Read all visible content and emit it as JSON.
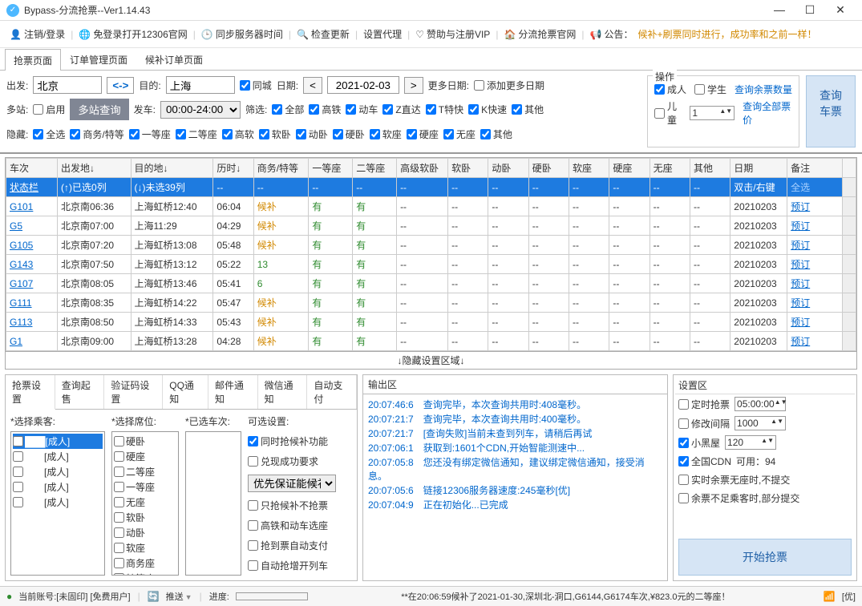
{
  "window": {
    "title": "Bypass-分流抢票--Ver1.14.43"
  },
  "toolbar": {
    "logout": "注销/登录",
    "openSite": "免登录打开12306官网",
    "sync": "同步服务器时间",
    "check": "检查更新",
    "proxy": "设置代理",
    "donate": "赞助与注册VIP",
    "site": "分流抢票官网",
    "notice": "公告：",
    "noticeMsg": "候补+刷票同时进行，成功率和之前一样！"
  },
  "mainTabs": {
    "t1": "抢票页面",
    "t2": "订单管理页面",
    "t3": "候补订单页面"
  },
  "search": {
    "fromLabel": "出发:",
    "fromVal": "北京",
    "toLabel": "目的:",
    "toVal": "上海",
    "sameCity": "同城",
    "dateLabel": "日期:",
    "dateVal": "2021-02-03",
    "moreDateLabel": "更多日期:",
    "addMoreDate": "添加更多日期",
    "multiLabel": "多站:",
    "enable": "启用",
    "multiBtn": "多站查询",
    "departLabel": "发车:",
    "departVal": "00:00-24:00",
    "filterLabel": "筛选:",
    "all": "全部",
    "gaotie": "高铁",
    "dongche": "动车",
    "zdirect": "Z直达",
    "tkuai": "T特快",
    "kkuai": "K快速",
    "other": "其他",
    "hideLabel": "隐藏:",
    "selAll": "全选",
    "bizFirst": "商务/特等",
    "first": "一等座",
    "second": "二等座",
    "gaoruan": "高软",
    "ruanwo": "软卧",
    "dongwo": "动卧",
    "yingwo": "硬卧",
    "ruanzuo": "软座",
    "yingzuo": "硬座",
    "wuzuo": "无座",
    "other2": "其他"
  },
  "ops": {
    "title": "操作",
    "adult": "成人",
    "student": "学生",
    "child": "儿童",
    "childNum": "1",
    "link1": "查询余票数量",
    "link2": "查询全部票价",
    "bigBtn": "查询\n车票"
  },
  "gridHeaders": [
    "车次",
    "出发地↓",
    "目的地↓",
    "历时↓",
    "商务/特等",
    "一等座",
    "二等座",
    "高级软卧",
    "软卧",
    "动卧",
    "硬卧",
    "软座",
    "硬座",
    "无座",
    "其他",
    "日期",
    "备注"
  ],
  "statusRow": {
    "a": "状态栏",
    "b": "(↑)已选0列",
    "c": "(↓)未选39列",
    "note": "双击/右键",
    "link": "全选"
  },
  "rows": [
    {
      "no": "G101",
      "from": "北京南06:36",
      "to": "上海虹桥12:40",
      "dur": "06:04",
      "biz": "候补",
      "c1": "有",
      "c2": "有",
      "date": "20210203",
      "act": "预订"
    },
    {
      "no": "G5",
      "from": "北京南07:00",
      "to": "上海11:29",
      "dur": "04:29",
      "biz": "候补",
      "c1": "有",
      "c2": "有",
      "date": "20210203",
      "act": "预订"
    },
    {
      "no": "G105",
      "from": "北京南07:20",
      "to": "上海虹桥13:08",
      "dur": "05:48",
      "biz": "候补",
      "c1": "有",
      "c2": "有",
      "date": "20210203",
      "act": "预订"
    },
    {
      "no": "G143",
      "from": "北京南07:50",
      "to": "上海虹桥13:12",
      "dur": "05:22",
      "biz": "13",
      "bizGreen": true,
      "c1": "有",
      "c2": "有",
      "date": "20210203",
      "act": "预订"
    },
    {
      "no": "G107",
      "from": "北京南08:05",
      "to": "上海虹桥13:46",
      "dur": "05:41",
      "biz": "6",
      "bizGreen": true,
      "c1": "有",
      "c2": "有",
      "date": "20210203",
      "act": "预订"
    },
    {
      "no": "G111",
      "from": "北京南08:35",
      "to": "上海虹桥14:22",
      "dur": "05:47",
      "biz": "候补",
      "c1": "有",
      "c2": "有",
      "date": "20210203",
      "act": "预订"
    },
    {
      "no": "G113",
      "from": "北京南08:50",
      "to": "上海虹桥14:33",
      "dur": "05:43",
      "biz": "候补",
      "c1": "有",
      "c2": "有",
      "date": "20210203",
      "act": "预订"
    },
    {
      "no": "G1",
      "from": "北京南09:00",
      "to": "上海虹桥13:28",
      "dur": "04:28",
      "biz": "候补",
      "c1": "有",
      "c2": "有",
      "date": "20210203",
      "act": "预订"
    }
  ],
  "hideBar": "↓隐藏设置区域↓",
  "settingsTabs": [
    "抢票设置",
    "查询起售",
    "验证码设置",
    "QQ通知",
    "邮件通知",
    "微信通知",
    "自动支付"
  ],
  "pickCols": {
    "passengerLabel": "*选择乘客:",
    "seatLabel": "*选择席位:",
    "trainLabel": "*已选车次:",
    "optLabel": "可选设置:",
    "passengers": [
      "[成人]",
      "[成人]",
      "[成人]",
      "[成人]",
      "[成人]"
    ],
    "seats": [
      "硬卧",
      "硬座",
      "二等座",
      "一等座",
      "无座",
      "软卧",
      "动卧",
      "软座",
      "商务座",
      "特等座"
    ],
    "opts": {
      "o1": "同时抢候补功能",
      "o2": "兑现成功要求",
      "sel": "优先保证能候补",
      "o3": "只抢候补不抢票",
      "o4": "高铁和动车选座",
      "o5": "抢到票自动支付",
      "o6": "自动抢增开列车"
    }
  },
  "output": {
    "title": "输出区",
    "lines": [
      "20:07:46:6　查询完毕，本次查询共用时:408毫秒。",
      "20:07:21:7　查询完毕，本次查询共用时:400毫秒。",
      "20:07:21:7　[查询失败]当前未查到列车，请稍后再试",
      "20:07:06:1　获取到:1601个CDN,开始智能测速中...",
      "20:07:05:8　您还没有绑定微信通知，建议绑定微信通知，接受消息。",
      "20:07:05:6　链接12306服务器速度:245毫秒[优]",
      "20:07:04:9　正在初始化...已完成"
    ]
  },
  "settingsPanel": {
    "title": "设置区",
    "timed": "定时抢票",
    "timedVal": "05:00:00",
    "interval": "修改间隔",
    "intervalVal": "1000",
    "blackroom": "小黑屋",
    "blackVal": "120",
    "cdn": "全国CDN",
    "cdnAvail": "可用：94",
    "noSeat": "实时余票无座时,不提交",
    "insuff": "余票不足乘客时,部分提交",
    "startBtn": "开始抢票"
  },
  "status": {
    "acct": "当前账号:[未固印] [免费用户]",
    "pushLabel": "推送",
    "progLabel": "进度:",
    "msg": "**在20:06:59候补了2021-01-30,深圳北-洞口,G6144,G6174车次,¥823.0元的二等座！",
    "opt": "[优]"
  }
}
